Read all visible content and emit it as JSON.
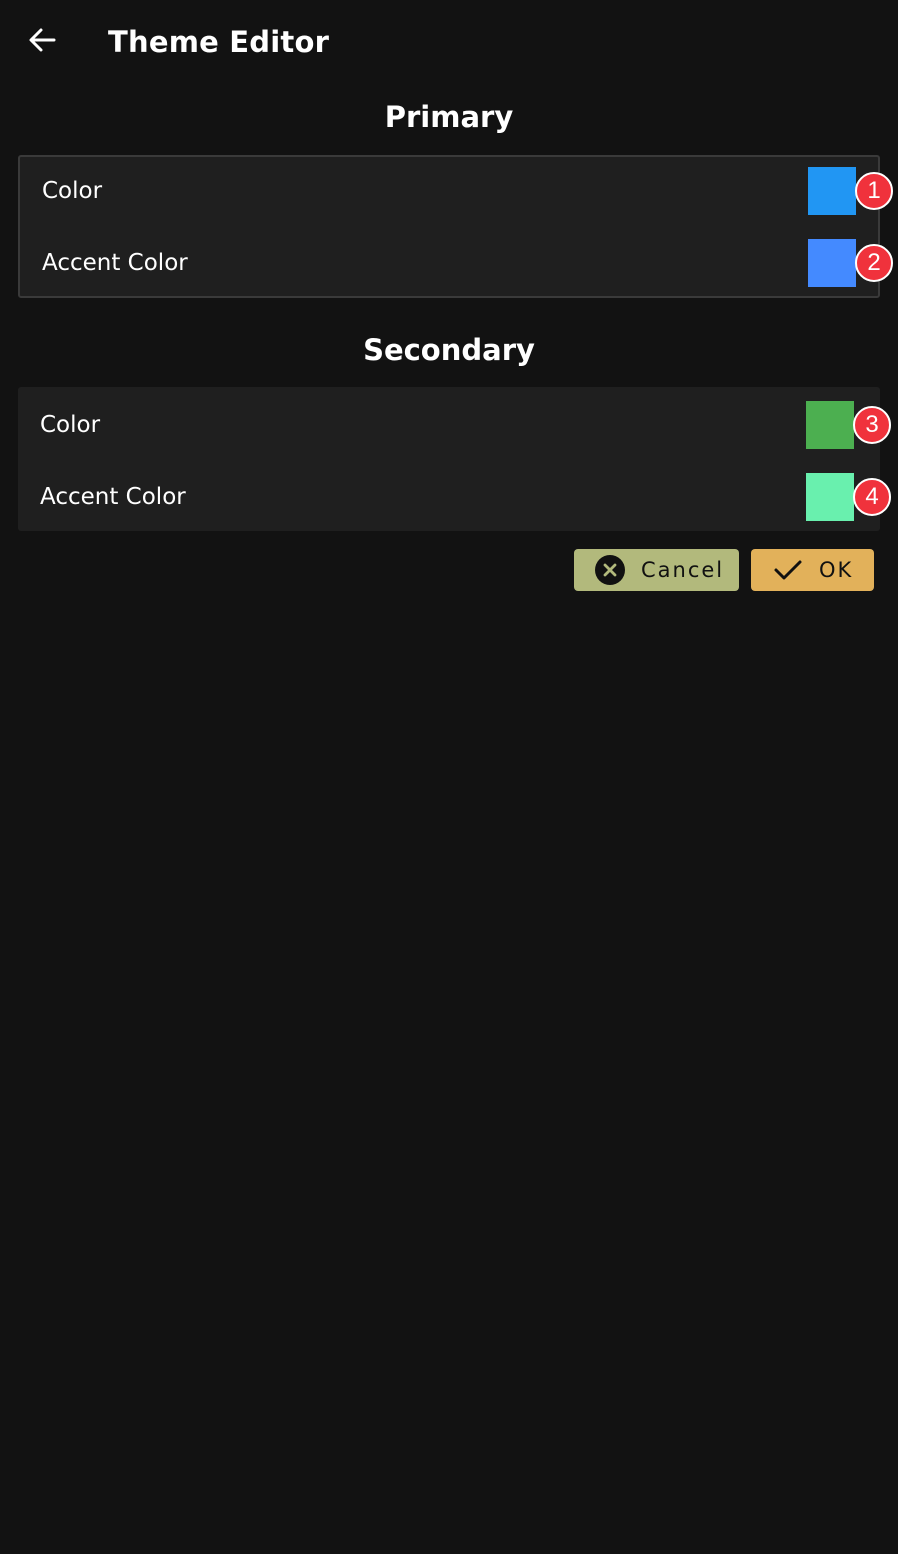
{
  "appbar": {
    "back_icon": "arrow-left-icon",
    "title": "Theme Editor"
  },
  "sections": [
    {
      "title": "Primary",
      "rows": [
        {
          "label": "Color",
          "color": "#2196f3",
          "badge": "1"
        },
        {
          "label": "Accent Color",
          "color": "#448aff",
          "badge": "2"
        }
      ]
    },
    {
      "title": "Secondary",
      "rows": [
        {
          "label": "Color",
          "color": "#4caf50",
          "badge": "3"
        },
        {
          "label": "Accent Color",
          "color": "#69f0ae",
          "badge": "4"
        }
      ]
    }
  ],
  "actions": {
    "cancel_label": "Cancel",
    "cancel_icon": "close-circle-icon",
    "cancel_color": "#b2b97c",
    "ok_label": "OK",
    "ok_icon": "check-icon",
    "ok_color": "#e2b15a"
  },
  "colors": {
    "background": "#121212",
    "card": "#1f1f1f",
    "badge": "#f0323c"
  }
}
